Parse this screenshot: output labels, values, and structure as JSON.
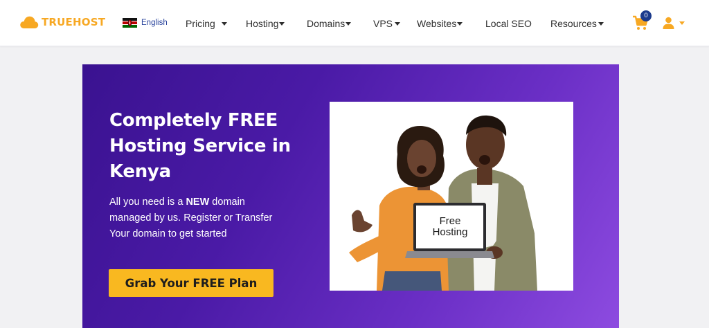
{
  "brand": {
    "name": "TRUEHOST",
    "color": "#f7a823"
  },
  "language": {
    "label": "English",
    "flag": "kenya-flag"
  },
  "nav": [
    {
      "label": "Pricing",
      "has_dropdown": true
    },
    {
      "label": "Hosting",
      "has_dropdown": true
    },
    {
      "label": "Domains",
      "has_dropdown": true
    },
    {
      "label": "VPS",
      "has_dropdown": true
    },
    {
      "label": "Websites",
      "has_dropdown": true
    },
    {
      "label": "Local SEO",
      "has_dropdown": false
    },
    {
      "label": "Resources",
      "has_dropdown": true
    }
  ],
  "cart": {
    "count": "0",
    "icon": "cart-icon"
  },
  "user": {
    "icon": "user-icon"
  },
  "hero": {
    "title": "Completely FREE Hosting Service in Kenya",
    "desc_before": "All you need is a ",
    "desc_bold": "NEW",
    "desc_after": " domain managed by us. Register or Transfer Your domain to get started",
    "cta_label": "Grab Your FREE Plan",
    "image": {
      "laptop_line1": "Free",
      "laptop_line2": "Hosting"
    }
  },
  "colors": {
    "accent": "#f9b820",
    "hero_start": "#3a1290",
    "hero_end": "#8d4be0",
    "badge": "#1b3a8c"
  }
}
